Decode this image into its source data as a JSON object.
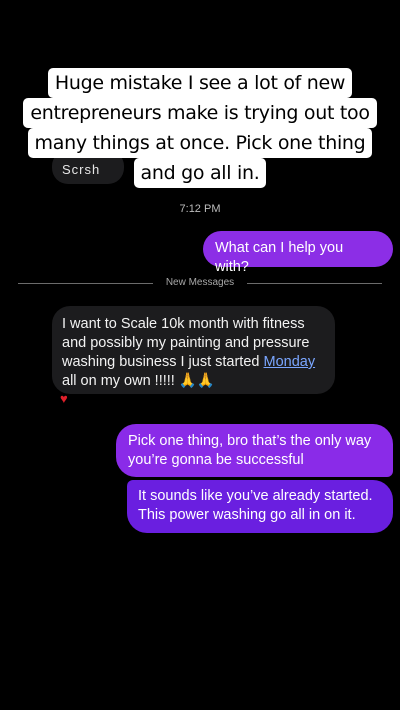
{
  "older_bubble": {
    "text": "Scrsh"
  },
  "caption": {
    "lines": [
      "Huge mistake I see a lot of new",
      "entrepreneurs make is trying out too",
      "many things at once. Pick one thing",
      "and go all in."
    ]
  },
  "timestamp": "7:12 PM",
  "messages": {
    "outgoing_1": "What can I help you with?",
    "divider_label": "New Messages",
    "incoming_1": {
      "text_before": "I want to Scale 10k month with fitness and possibly my painting and pressure washing business I just started ",
      "link": "Monday",
      "text_after": " all on my own !!!!! 🙏🙏"
    },
    "reaction": "♥",
    "outgoing_2": "Pick one thing, bro that’s the only way you’re gonna be successful",
    "outgoing_3": "It sounds like you’ve already started. This power washing go all in on it."
  },
  "colors": {
    "outgoing_bubble": "#8a2be8",
    "outgoing_bubble_last": "#6a1fe0",
    "incoming_bubble": "#1c1c1e",
    "link": "#7aa6ff",
    "heart": "#e0202a"
  }
}
